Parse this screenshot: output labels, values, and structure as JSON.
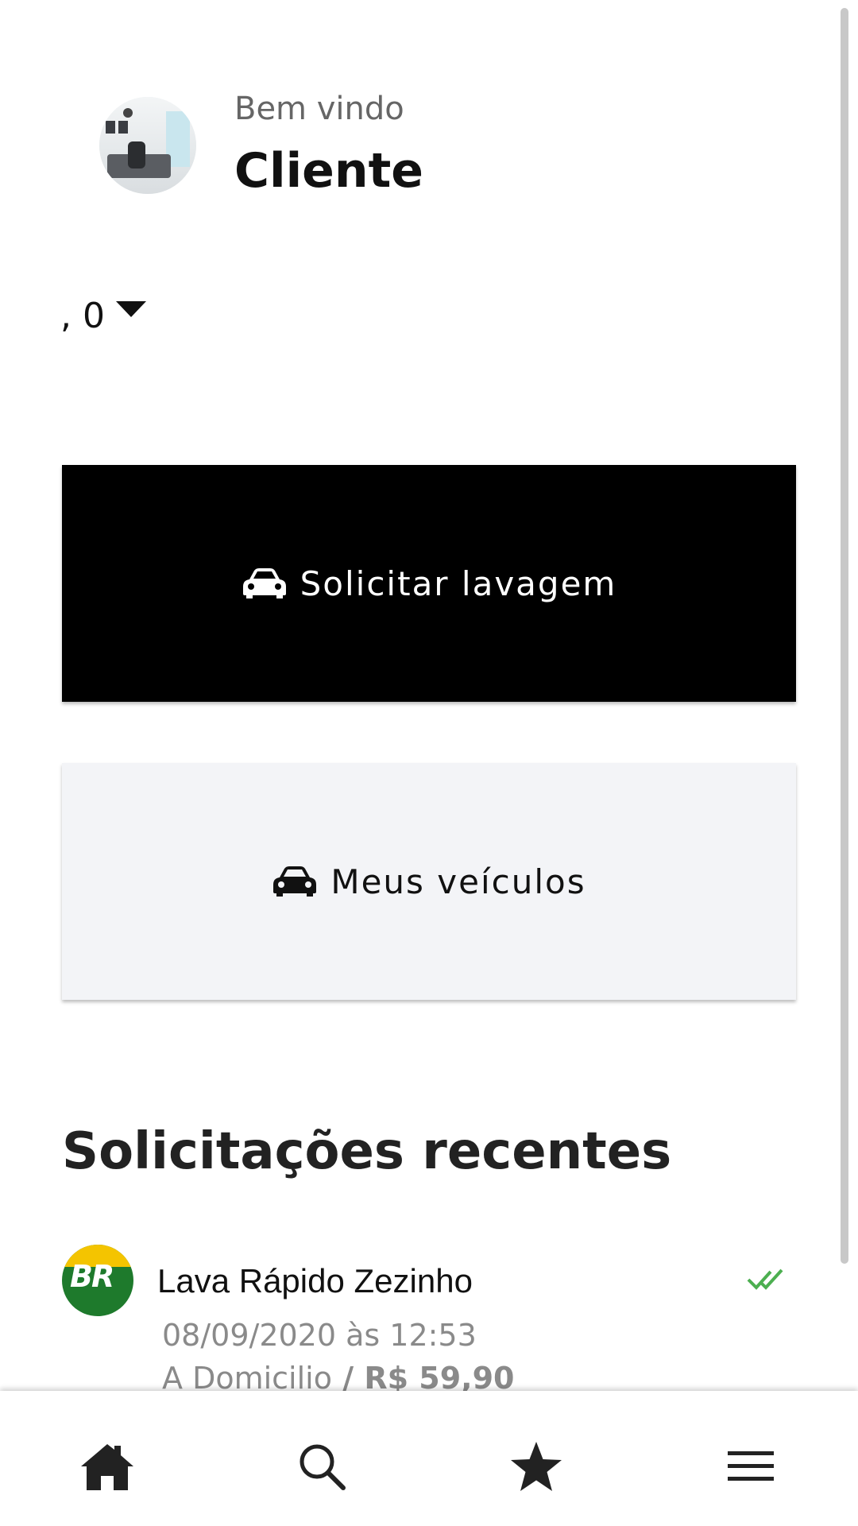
{
  "header": {
    "welcome_label": "Bem vindo",
    "client_name": "Cliente"
  },
  "location": {
    "value": ", 0"
  },
  "actions": {
    "request_wash_label": "Solicitar lavagem",
    "my_vehicles_label": "Meus veículos"
  },
  "recent": {
    "title": "Solicitações recentes",
    "items": [
      {
        "name": "Lava Rápido Zezinho",
        "logo_text": "BR",
        "datetime": "08/09/2020 às 12:53",
        "service_type": "A Domicilio",
        "separator": " / ",
        "price": "R$ 59,90",
        "status_icon": "double-check-icon",
        "status_color": "#4caf50"
      }
    ]
  },
  "bottom_nav": {
    "items": [
      "home-icon",
      "search-icon",
      "star-icon",
      "menu-icon"
    ]
  },
  "colors": {
    "primary_button": "#000000",
    "secondary_button": "#f3f4f7",
    "muted_text": "#8a8a8a"
  }
}
